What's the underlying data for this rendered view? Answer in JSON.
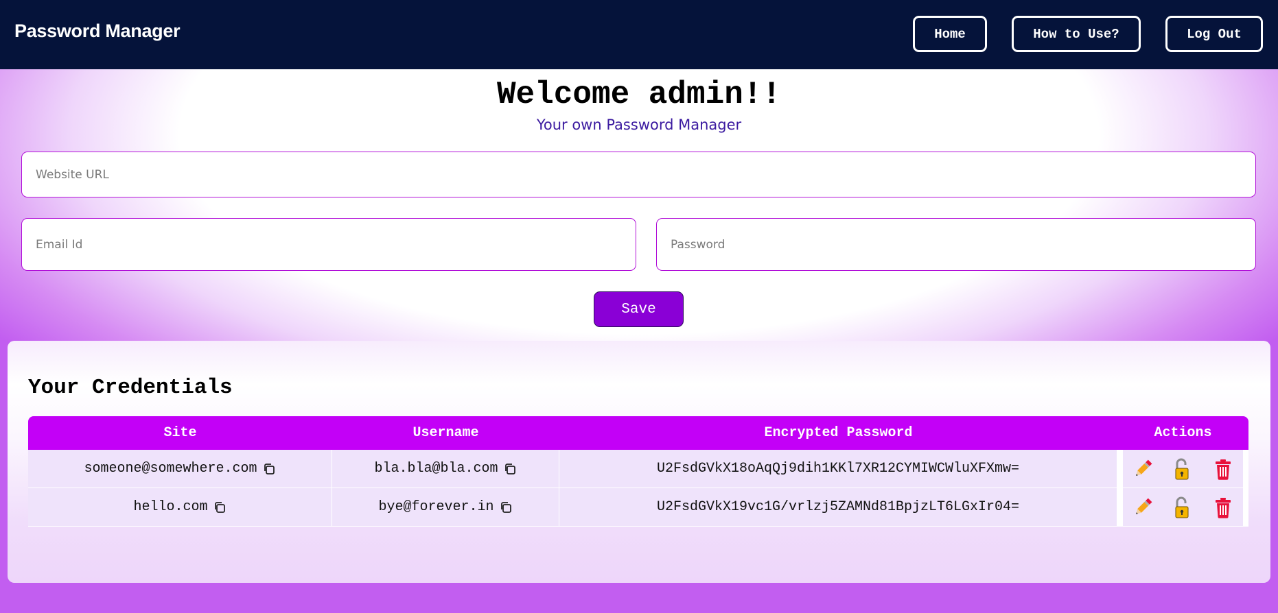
{
  "nav": {
    "brand": "Password Manager",
    "home": "Home",
    "how_to_use": "How to Use?",
    "logout": "Log Out"
  },
  "header": {
    "welcome": "Welcome admin!!",
    "subtitle": "Your own Password Manager"
  },
  "form": {
    "url_placeholder": "Website URL",
    "email_placeholder": "Email Id",
    "password_placeholder": "Password",
    "save_label": "Save"
  },
  "credentials": {
    "title": "Your Credentials",
    "columns": [
      "Site",
      "Username",
      "Encrypted Password",
      "Actions"
    ],
    "rows": [
      {
        "site": "someone@somewhere.com",
        "username": "bla.bla@bla.com",
        "encrypted": "U2FsdGVkX18oAqQj9dih1KKl7XR12CYMIWCWluXFXmw="
      },
      {
        "site": "hello.com",
        "username": "bye@forever.in",
        "encrypted": "U2FsdGVkX19vc1G/vrlzj5ZAMNd81BpjzLT6LGxIr04="
      }
    ],
    "action_icons": [
      "pencil-icon",
      "unlock-icon",
      "trash-icon"
    ]
  },
  "colors": {
    "navbar": "#05133a",
    "accent": "#c300f7",
    "save_button": "#8a00d6",
    "delete": "#e8113a"
  }
}
